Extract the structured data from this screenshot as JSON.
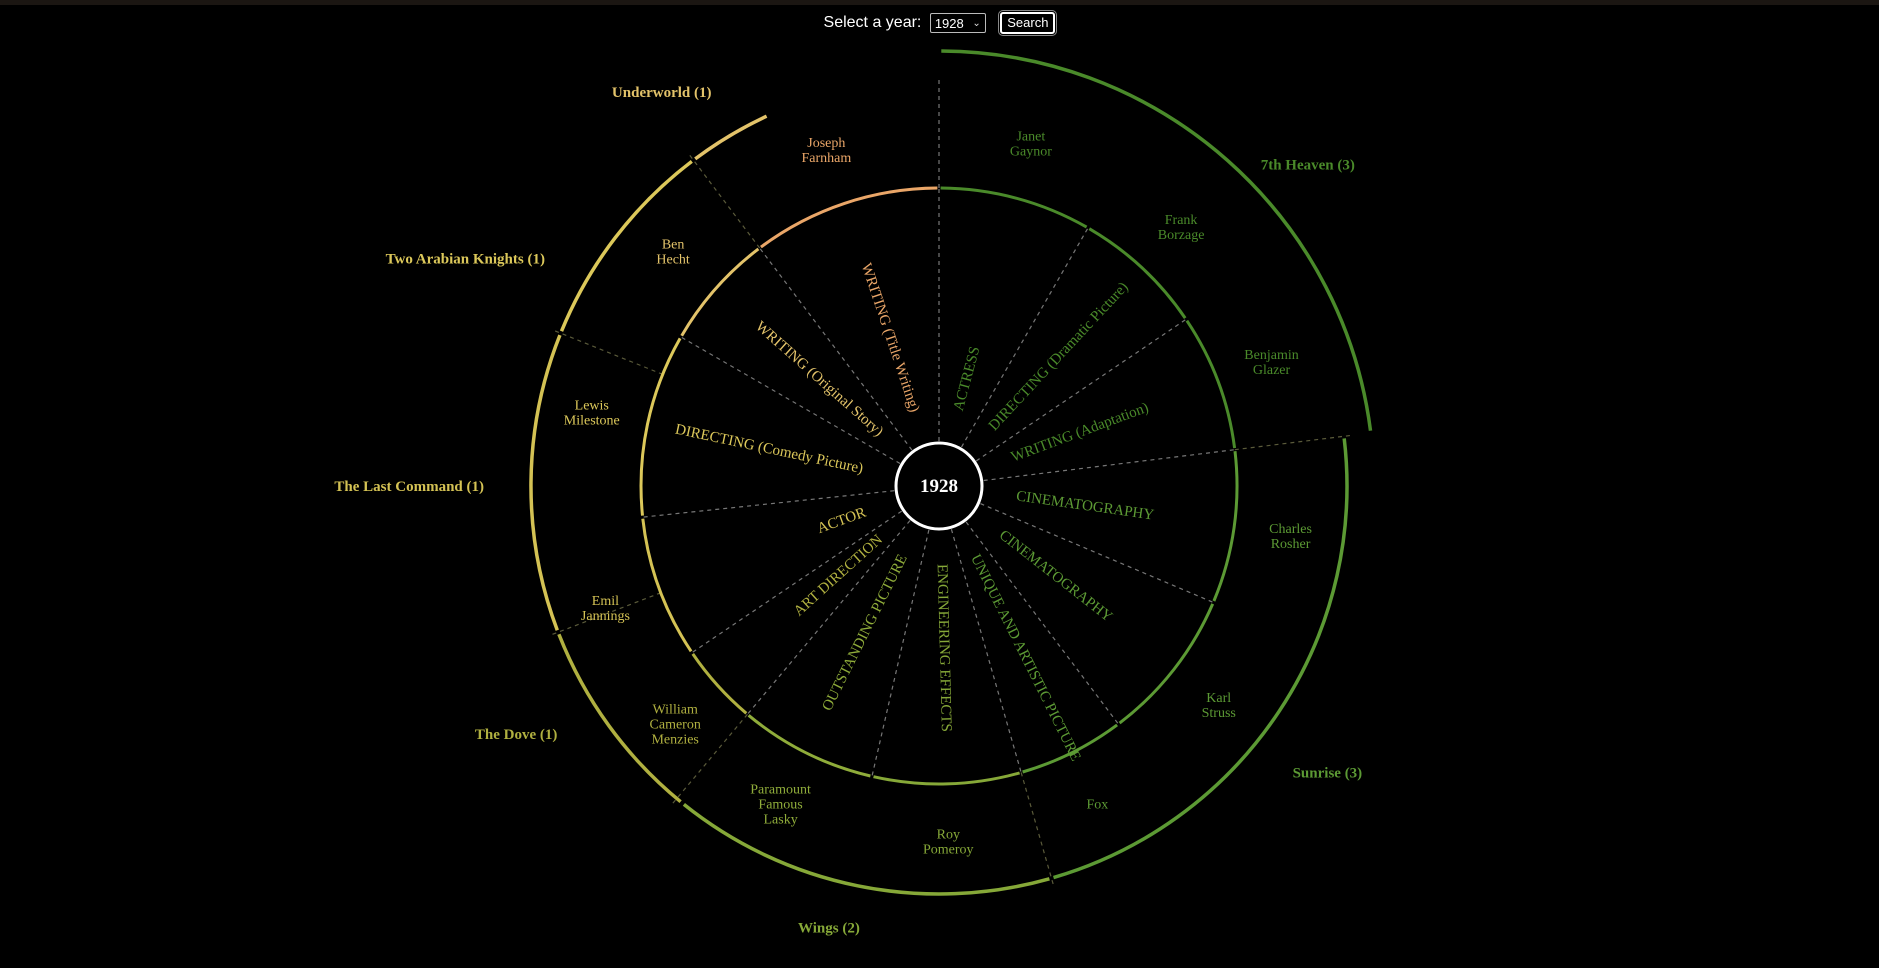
{
  "controls": {
    "label": "Select a year:",
    "selected_year": "1928",
    "search_label": "Search"
  },
  "center": {
    "label": "1928"
  },
  "colors": {
    "background": "#000000",
    "green_dark": "#4a8a2a",
    "green_mid": "#5c9a34",
    "green_light": "#86a838",
    "olive": "#b0b040",
    "yellow": "#d4c254",
    "gold": "#e3c36a",
    "orange": "#eaa668",
    "divider": "#777777"
  },
  "films": [
    {
      "label": "7th Heaven (3)",
      "color": "#4a8a2a"
    },
    {
      "label": "Sunrise (3)",
      "color": "#5c9a34"
    },
    {
      "label": "Wings (2)",
      "color": "#86a838"
    },
    {
      "label": "The Dove (1)",
      "color": "#b0b040"
    },
    {
      "label": "The Last Command (1)",
      "color": "#d4c254"
    },
    {
      "label": "Two Arabian Knights (1)",
      "color": "#dcc85a"
    },
    {
      "label": "Underworld (1)",
      "color": "#e3c36a"
    }
  ],
  "nominees": [
    {
      "name": [
        "Janet",
        "Gaynor"
      ],
      "category": "ACTRESS",
      "color": "#4a8a2a"
    },
    {
      "name": [
        "Frank",
        "Borzage"
      ],
      "category": "DIRECTING (Dramatic Picture)",
      "color": "#4a8a2a"
    },
    {
      "name": [
        "Benjamin",
        "Glazer"
      ],
      "category": "WRITING (Adaptation)",
      "color": "#4a8a2a"
    },
    {
      "name": [
        "Charles",
        "Rosher"
      ],
      "category": "CINEMATOGRAPHY",
      "color": "#5c9a34"
    },
    {
      "name": [
        "Karl",
        "Struss"
      ],
      "category": "CINEMATOGRAPHY",
      "color": "#5c9a34"
    },
    {
      "name": [
        "Fox"
      ],
      "category": "UNIQUE AND ARTISTIC PICTURE",
      "color": "#5c9a34"
    },
    {
      "name": [
        "Roy",
        "Pomeroy"
      ],
      "category": "ENGINEERING EFFECTS",
      "color": "#86a838"
    },
    {
      "name": [
        "Paramount",
        "Famous",
        "Lasky"
      ],
      "category": "OUTSTANDING PICTURE",
      "color": "#8fac3a"
    },
    {
      "name": [
        "William",
        "Cameron",
        "Menzies"
      ],
      "category": "ART DIRECTION",
      "color": "#b0b040"
    },
    {
      "name": [
        "Emil",
        "Jannings"
      ],
      "category": "ACTOR",
      "color": "#d4c254"
    },
    {
      "name": [
        "Lewis",
        "Milestone"
      ],
      "category": "DIRECTING (Comedy Picture)",
      "color": "#dcc85a"
    },
    {
      "name": [
        "Ben",
        "Hecht"
      ],
      "category": "WRITING (Original Story)",
      "color": "#e3c36a"
    },
    {
      "name": [
        "Joseph",
        "Farnham"
      ],
      "category": "WRITING (Title Writing)",
      "color": "#eaa668"
    }
  ]
}
